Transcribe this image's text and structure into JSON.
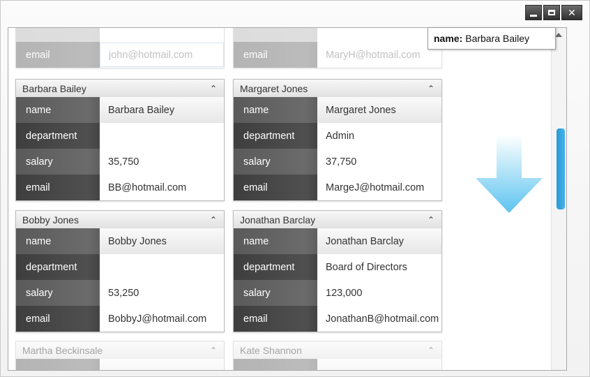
{
  "tooltip": {
    "label": "name:",
    "value": "Barbara Bailey"
  },
  "partial_top": [
    {
      "key": "email",
      "value": "john@hotmail.com"
    },
    {
      "key": "email",
      "value": "MaryH@hotmail.com"
    }
  ],
  "cards": [
    {
      "title": "Barbara Bailey",
      "rows": [
        {
          "key": "name",
          "value": "Barbara Bailey"
        },
        {
          "key": "department",
          "value": ""
        },
        {
          "key": "salary",
          "value": "35,750"
        },
        {
          "key": "email",
          "value": "BB@hotmail.com"
        }
      ]
    },
    {
      "title": "Margaret Jones",
      "rows": [
        {
          "key": "name",
          "value": "Margaret Jones"
        },
        {
          "key": "department",
          "value": "Admin"
        },
        {
          "key": "salary",
          "value": "37,750"
        },
        {
          "key": "email",
          "value": "MargeJ@hotmail.com"
        }
      ]
    },
    {
      "title": "Bobby Jones",
      "rows": [
        {
          "key": "name",
          "value": "Bobby Jones"
        },
        {
          "key": "department",
          "value": ""
        },
        {
          "key": "salary",
          "value": "53,250"
        },
        {
          "key": "email",
          "value": "BobbyJ@hotmail.com"
        }
      ]
    },
    {
      "title": "Jonathan Barclay",
      "rows": [
        {
          "key": "name",
          "value": "Jonathan Barclay"
        },
        {
          "key": "department",
          "value": "Board of Directors"
        },
        {
          "key": "salary",
          "value": "123,000"
        },
        {
          "key": "email",
          "value": "JonathanB@hotmail.com"
        }
      ]
    }
  ],
  "partial_bottom": [
    {
      "title": "Martha Beckinsale"
    },
    {
      "title": "Kate Shannon"
    }
  ],
  "icons": {
    "collapse": "collapse-chevron-icon",
    "arrow": "down-arrow-icon"
  },
  "colors": {
    "accent": "#2a98d5",
    "arrow": "#5cc3ef"
  }
}
